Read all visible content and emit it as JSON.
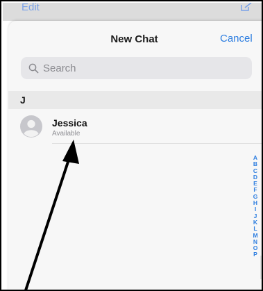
{
  "background_screen": {
    "edit_label": "Edit"
  },
  "header": {
    "title": "New Chat",
    "cancel_label": "Cancel"
  },
  "search": {
    "placeholder": "Search"
  },
  "sections": [
    {
      "letter": "J",
      "contacts": [
        {
          "name": "Jessica",
          "status": "Available"
        }
      ]
    }
  ],
  "alphabet_index": [
    "A",
    "B",
    "C",
    "D",
    "E",
    "F",
    "G",
    "H",
    "I",
    "J",
    "K",
    "L",
    "M",
    "N",
    "O",
    "P"
  ],
  "colors": {
    "accent": "#2c7de0",
    "sheet_background": "#f7f7f7",
    "section_background": "#e9e9e9",
    "secondary_text": "#8e8e93"
  },
  "icons": {
    "search": "magnifier-icon",
    "avatar": "person-silhouette-icon",
    "compose": "compose-icon"
  }
}
